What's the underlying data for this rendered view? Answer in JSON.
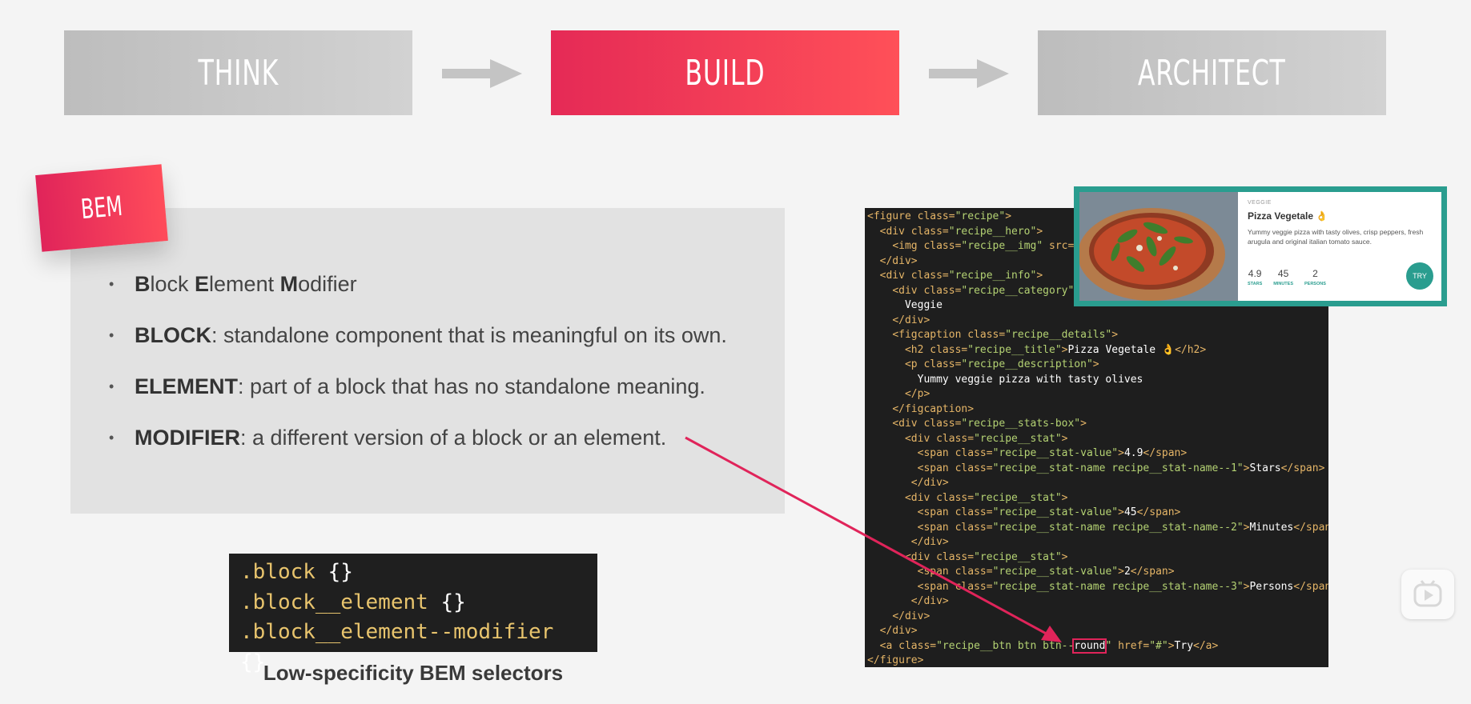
{
  "flow": {
    "steps": [
      "THINK",
      "BUILD",
      "ARCHITECT"
    ],
    "active": "BUILD",
    "colors": {
      "active": "#e52a56",
      "inactive": "#c8c8c8"
    }
  },
  "tag": "BEM",
  "bullets": [
    {
      "parts": [
        [
          "b",
          "B"
        ],
        [
          "t",
          "lock "
        ],
        [
          "b",
          "E"
        ],
        [
          "t",
          "lement "
        ],
        [
          "b",
          "M"
        ],
        [
          "t",
          "odifier"
        ]
      ]
    },
    {
      "parts": [
        [
          "b",
          "BLOCK"
        ],
        [
          "t",
          ": standalone component that is meaningful on its own."
        ]
      ]
    },
    {
      "parts": [
        [
          "b",
          "ELEMENT"
        ],
        [
          "t",
          ": part of a block that has no standalone meaning."
        ]
      ]
    },
    {
      "parts": [
        [
          "b",
          "MODIFIER"
        ],
        [
          "t",
          ": a different version of a block or an element."
        ]
      ]
    }
  ],
  "selectors": {
    "lines": [
      ".block",
      ".block__element",
      ".block__element--modifier"
    ],
    "braces": "{}",
    "caption": "Low-specificity BEM selectors"
  },
  "code": {
    "lines": [
      [
        [
          "tg",
          "<figure "
        ],
        [
          "at",
          "class="
        ],
        [
          "st",
          "\"recipe\""
        ],
        [
          "tg",
          ">"
        ]
      ],
      [
        [
          "tx",
          "  "
        ],
        [
          "tg",
          "<div "
        ],
        [
          "at",
          "class="
        ],
        [
          "st",
          "\"recipe__hero\""
        ],
        [
          "tg",
          ">"
        ]
      ],
      [
        [
          "tx",
          "    "
        ],
        [
          "tg",
          "<img "
        ],
        [
          "at",
          "class="
        ],
        [
          "st",
          "\"recipe__img\""
        ],
        [
          "tx",
          " "
        ],
        [
          "at",
          "src="
        ],
        [
          "st",
          "\""
        ]
      ],
      [
        [
          "tx",
          "  "
        ],
        [
          "tg",
          "</div>"
        ]
      ],
      [
        [
          "tx",
          "  "
        ],
        [
          "tg",
          "<div "
        ],
        [
          "at",
          "class="
        ],
        [
          "st",
          "\"recipe__info\""
        ],
        [
          "tg",
          ">"
        ]
      ],
      [
        [
          "tx",
          "    "
        ],
        [
          "tg",
          "<div "
        ],
        [
          "at",
          "class="
        ],
        [
          "st",
          "\"recipe__category\""
        ],
        [
          "tg",
          ">"
        ]
      ],
      [
        [
          "tx",
          "      Veggie"
        ]
      ],
      [
        [
          "tx",
          "    "
        ],
        [
          "tg",
          "</div>"
        ]
      ],
      [
        [
          "tx",
          "    "
        ],
        [
          "tg",
          "<figcaption "
        ],
        [
          "at",
          "class="
        ],
        [
          "st",
          "\"recipe__details\""
        ],
        [
          "tg",
          ">"
        ]
      ],
      [
        [
          "tx",
          "      "
        ],
        [
          "tg",
          "<h2 "
        ],
        [
          "at",
          "class="
        ],
        [
          "st",
          "\"recipe__title\""
        ],
        [
          "tg",
          ">"
        ],
        [
          "tx",
          "Pizza Vegetale 👌"
        ],
        [
          "tg",
          "</h2>"
        ]
      ],
      [
        [
          "tx",
          "      "
        ],
        [
          "tg",
          "<p "
        ],
        [
          "at",
          "class="
        ],
        [
          "st",
          "\"recipe__description\""
        ],
        [
          "tg",
          ">"
        ]
      ],
      [
        [
          "tx",
          "        Yummy veggie pizza with tasty olives"
        ]
      ],
      [
        [
          "tx",
          "      "
        ],
        [
          "tg",
          "</p>"
        ]
      ],
      [
        [
          "tx",
          "    "
        ],
        [
          "tg",
          "</figcaption>"
        ]
      ],
      [
        [
          "tx",
          "    "
        ],
        [
          "tg",
          "<div "
        ],
        [
          "at",
          "class="
        ],
        [
          "st",
          "\"recipe__stats-box\""
        ],
        [
          "tg",
          ">"
        ]
      ],
      [
        [
          "tx",
          "      "
        ],
        [
          "tg",
          "<div "
        ],
        [
          "at",
          "class="
        ],
        [
          "st",
          "\"recipe__stat\""
        ],
        [
          "tg",
          ">"
        ]
      ],
      [
        [
          "tx",
          "        "
        ],
        [
          "tg",
          "<span "
        ],
        [
          "at",
          "class="
        ],
        [
          "st",
          "\"recipe__stat-value\""
        ],
        [
          "tg",
          ">"
        ],
        [
          "tx",
          "4.9"
        ],
        [
          "tg",
          "</span>"
        ]
      ],
      [
        [
          "tx",
          "        "
        ],
        [
          "tg",
          "<span "
        ],
        [
          "at",
          "class="
        ],
        [
          "st",
          "\"recipe__stat-name recipe__stat-name--1\""
        ],
        [
          "tg",
          ">"
        ],
        [
          "tx",
          "Stars"
        ],
        [
          "tg",
          "</span>"
        ]
      ],
      [
        [
          "tx",
          "       "
        ],
        [
          "tg",
          "</div>"
        ]
      ],
      [
        [
          "tx",
          "      "
        ],
        [
          "tg",
          "<div "
        ],
        [
          "at",
          "class="
        ],
        [
          "st",
          "\"recipe__stat\""
        ],
        [
          "tg",
          ">"
        ]
      ],
      [
        [
          "tx",
          "        "
        ],
        [
          "tg",
          "<span "
        ],
        [
          "at",
          "class="
        ],
        [
          "st",
          "\"recipe__stat-value\""
        ],
        [
          "tg",
          ">"
        ],
        [
          "tx",
          "45"
        ],
        [
          "tg",
          "</span>"
        ]
      ],
      [
        [
          "tx",
          "        "
        ],
        [
          "tg",
          "<span "
        ],
        [
          "at",
          "class="
        ],
        [
          "st",
          "\"recipe__stat-name recipe__stat-name--2\""
        ],
        [
          "tg",
          ">"
        ],
        [
          "tx",
          "Minutes"
        ],
        [
          "tg",
          "</span>"
        ]
      ],
      [
        [
          "tx",
          "       "
        ],
        [
          "tg",
          "</div>"
        ]
      ],
      [
        [
          "tx",
          "      "
        ],
        [
          "tg",
          "<div "
        ],
        [
          "at",
          "class="
        ],
        [
          "st",
          "\"recipe__stat\""
        ],
        [
          "tg",
          ">"
        ]
      ],
      [
        [
          "tx",
          "        "
        ],
        [
          "tg",
          "<span "
        ],
        [
          "at",
          "class="
        ],
        [
          "st",
          "\"recipe__stat-value\""
        ],
        [
          "tg",
          ">"
        ],
        [
          "tx",
          "2"
        ],
        [
          "tg",
          "</span>"
        ]
      ],
      [
        [
          "tx",
          "        "
        ],
        [
          "tg",
          "<span "
        ],
        [
          "at",
          "class="
        ],
        [
          "st",
          "\"recipe__stat-name recipe__stat-name--3\""
        ],
        [
          "tg",
          ">"
        ],
        [
          "tx",
          "Persons"
        ],
        [
          "tg",
          "</span>"
        ]
      ],
      [
        [
          "tx",
          "       "
        ],
        [
          "tg",
          "</div>"
        ]
      ],
      [
        [
          "tx",
          "    "
        ],
        [
          "tg",
          "</div>"
        ]
      ],
      [
        [
          "tx",
          "  "
        ],
        [
          "tg",
          "</div>"
        ]
      ],
      [
        [
          "tx",
          "  "
        ],
        [
          "tg",
          "<a "
        ],
        [
          "at",
          "class="
        ],
        [
          "st",
          "\"recipe__btn btn btn--"
        ],
        [
          "hl",
          "round"
        ],
        [
          "st",
          "\""
        ],
        [
          "tx",
          " "
        ],
        [
          "at",
          "href="
        ],
        [
          "st",
          "\"#\""
        ],
        [
          "tg",
          ">"
        ],
        [
          "tx",
          "Try"
        ],
        [
          "tg",
          "</a>"
        ]
      ],
      [
        [
          "tg",
          "</figure>"
        ]
      ]
    ]
  },
  "card": {
    "category": "VEGGIE",
    "title": "Pizza Vegetale 👌",
    "description": "Yummy veggie pizza with tasty olives, crisp peppers, fresh arugula and original italian tomato sauce.",
    "stats": [
      {
        "value": "4.9",
        "name": "STARS"
      },
      {
        "value": "45",
        "name": "MINUTES"
      },
      {
        "value": "2",
        "name": "PERSONS"
      }
    ],
    "button": "TRY",
    "accent": "#2a9d8f"
  }
}
